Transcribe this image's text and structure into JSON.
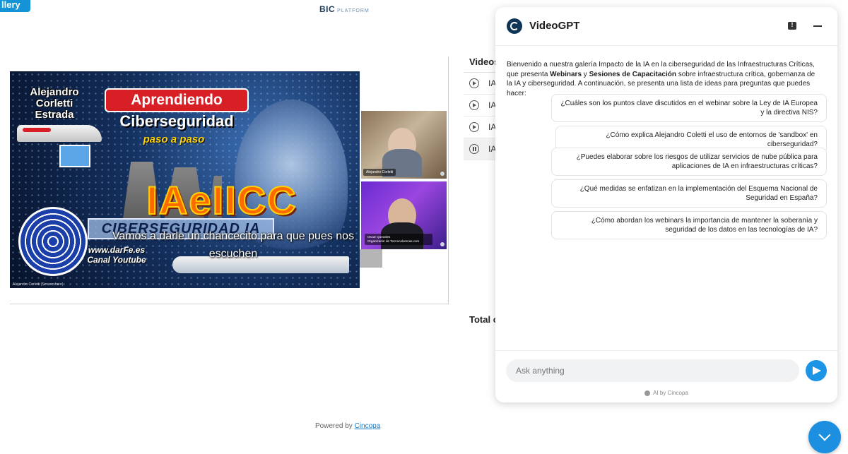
{
  "header": {
    "gallery_label": "llery",
    "logo_main": "BIC",
    "logo_sub": "PLATFORM"
  },
  "video": {
    "author_line1": "Alejandro",
    "author_line2": "Corletti",
    "author_line3": "Estrada",
    "banner": "Aprendiendo",
    "subtitle": "Ciberseguridad",
    "subtitle2": "paso a paso",
    "main_title": "IAeIICC",
    "strip": "CIBERSEGURIDAD IA",
    "site": "www.darFe.es",
    "channel": "Canal Youtube",
    "presenter_tag": "Alejandro Corletti (Screenshare)",
    "caption": "Vamos a darle un chancecito para que pues nos escuchen"
  },
  "cams": [
    {
      "name": "Alejandro Corletti"
    },
    {
      "name": "Oscar Quezales",
      "role": "Organizador de Tecnocolumnas.com"
    }
  ],
  "videos_panel": {
    "title": "Videos",
    "items": [
      {
        "label": "IA",
        "state": "play"
      },
      {
        "label": "IA",
        "state": "play"
      },
      {
        "label": "IA",
        "state": "play"
      },
      {
        "label": "IA",
        "state": "pause"
      }
    ],
    "total_label": "Total c"
  },
  "footer": {
    "powered_prefix": "Powered by",
    "powered_link": "Cincopa"
  },
  "chat": {
    "title": "VideoGPT",
    "intro_part1": "Bienvenido a nuestra galería Impacto de la IA en la ciberseguridad de las Infraestructuras Críticas, que presenta ",
    "intro_bold1": "Webinars",
    "intro_part2": " y ",
    "intro_bold2": "Sesiones de Capacitación",
    "intro_part3": " sobre infraestructura crítica, gobernanza de la IA y ciberseguridad. A continuación, se presenta una lista de ideas para preguntas que puedes hacer:",
    "suggestions": [
      "¿Cuáles son los puntos clave discutidos en el webinar sobre la Ley de IA Europea y la directiva NIS?",
      "¿Cómo explica Alejandro Coletti el uso de entornos de 'sandbox' en ciberseguridad?",
      "¿Puedes elaborar sobre los riesgos de utilizar servicios de nube pública para aplicaciones de IA en infraestructuras críticas?",
      "¿Qué medidas se enfatizan en la implementación del Esquema Nacional de Seguridad en España?",
      "¿Cómo abordan los webinars la importancia de mantener la soberanía y seguridad de los datos en las tecnologías de IA?"
    ],
    "input_placeholder": "Ask anything",
    "ai_by": "AI by Cincopa"
  },
  "colors": {
    "accent": "#1c95e6",
    "brand_dark": "#0f3556"
  }
}
